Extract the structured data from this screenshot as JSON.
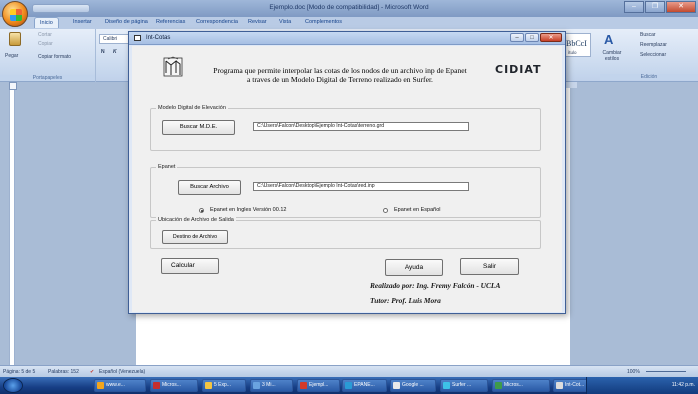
{
  "word": {
    "title": "Ejemplo.doc [Modo de compatibilidad] - Microsoft Word",
    "tabs": [
      "Inicio",
      "Insertar",
      "Diseño de página",
      "Referencias",
      "Correspondencia",
      "Revisar",
      "Vista",
      "Complementos"
    ],
    "ribbon": {
      "paste": "Pegar",
      "cut": "Cortar",
      "copy": "Copiar",
      "format_painter": "Copiar formato",
      "clipboard_group": "Portapapeles",
      "font_name": "Calibri",
      "bold": "N",
      "italic": "K",
      "style_preview": "BbCcI",
      "style_name": "ítulo",
      "change_styles": "Cambiar estilos",
      "find": "Buscar",
      "replace": "Reemplazar",
      "select": "Seleccionar",
      "editing_group": "Edición"
    },
    "status": {
      "page": "Página: 5 de 5",
      "words": "Palabras: 152",
      "language": "Español (Venezuela)",
      "zoom": "100%"
    },
    "taskbar": [
      {
        "label": "www.e...",
        "color": "#f2a51d"
      },
      {
        "label": "Micros...",
        "color": "#c62f2f"
      },
      {
        "label": "5 Exp...",
        "color": "#f4c542"
      },
      {
        "label": "3 Mi...",
        "color": "#6aa3e0"
      },
      {
        "label": "Ejempl...",
        "color": "#d33b2b"
      },
      {
        "label": "EPANE...",
        "color": "#2a9bd6"
      },
      {
        "label": "Google ...",
        "color": "#e9e9e9"
      },
      {
        "label": "Surfer ...",
        "color": "#3dc2e8"
      },
      {
        "label": "Micros...",
        "color": "#3f9b4a"
      },
      {
        "label": "Int-Cot...",
        "color": "#dddddd"
      }
    ],
    "clock": "11:42 p.m."
  },
  "dialog": {
    "title": "Int-Cotas",
    "header_line1": "Programa que permite interpolar las cotas de los nodos de un archivo inp de Epanet",
    "header_line2": "a traves de un Modelo Digital de Terreno realizado en Surfer.",
    "brand": "CIDIAT",
    "mde_group": "Modelo Digital de Elevación",
    "mde_button": "Buscar M.D.E.",
    "mde_path": "C:\\Users\\Falcon\\Desktop\\Ejemplo Int-Cotas\\terreno.grd",
    "epanet_group": "Epanet",
    "epanet_button": "Buscar Archivo",
    "epanet_path": "C:\\Users\\Falcon\\Desktop\\Ejemplo Int-Cotas\\red.inp",
    "radio_english": "Epanet en Ingles Versión 00.12",
    "radio_spanish": "Epanet en Español",
    "radio_selected": "english",
    "output_group": "Ubicación de Archivo de Salida",
    "output_button": "Destino de Archivo",
    "calc_button": "Calcular",
    "help_button": "Ayuda",
    "exit_button": "Salir",
    "credit1": "Realizado por: Ing. Fremy Falcón - UCLA",
    "credit2": "Tutor: Prof. Luis Mora"
  }
}
